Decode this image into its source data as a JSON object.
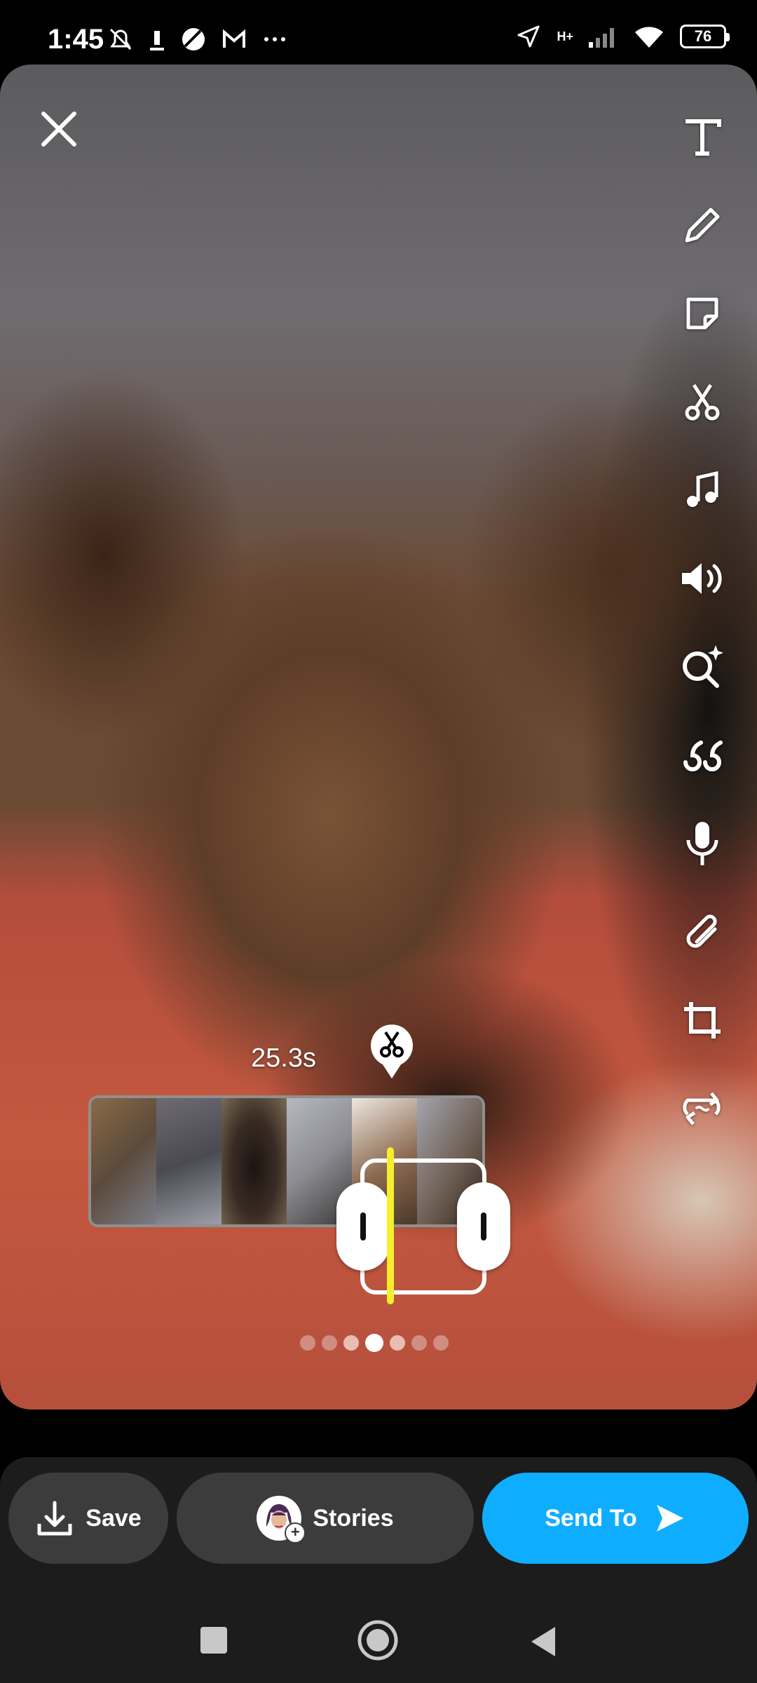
{
  "status_bar": {
    "time": "1:45",
    "network_label": "H+",
    "battery": "76",
    "icons": [
      "mute-icon",
      "download-icon",
      "circle-app-icon",
      "gmail-icon",
      "more-dots-icon",
      "location-arrow-icon",
      "signal-icon",
      "wifi-icon",
      "battery-icon"
    ]
  },
  "editor": {
    "close_icon": "close-icon",
    "tools": [
      {
        "name": "text-tool",
        "icon": "text-icon"
      },
      {
        "name": "draw-tool",
        "icon": "pencil-icon"
      },
      {
        "name": "sticker-tool",
        "icon": "sticker-icon"
      },
      {
        "name": "scissors-tool",
        "icon": "scissors-icon"
      },
      {
        "name": "music-tool",
        "icon": "music-icon"
      },
      {
        "name": "sound-tool",
        "icon": "speaker-icon"
      },
      {
        "name": "lens-tool",
        "icon": "magic-search-icon"
      },
      {
        "name": "quote-tool",
        "icon": "quote-icon"
      },
      {
        "name": "voice-tool",
        "icon": "microphone-icon"
      },
      {
        "name": "attach-tool",
        "icon": "paperclip-icon"
      },
      {
        "name": "crop-tool",
        "icon": "crop-icon"
      },
      {
        "name": "loop-tool",
        "icon": "loop-icon"
      }
    ]
  },
  "trim": {
    "duration": "25.3s",
    "page_count": 7,
    "active_page": 4
  },
  "actions": {
    "save_label": "Save",
    "stories_label": "Stories",
    "send_label": "Send To"
  },
  "colors": {
    "send_button": "#0fadff",
    "playhead": "#f4ee2c",
    "bar_background": "#1c1c1c",
    "pill_background": "#3c3c3c"
  }
}
